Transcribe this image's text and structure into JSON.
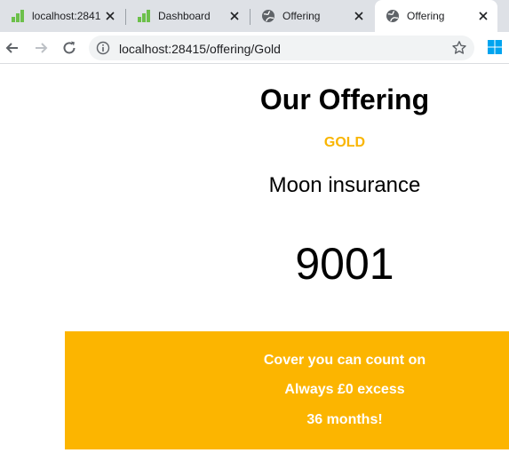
{
  "browser": {
    "tabs": [
      {
        "label": "localhost:2841",
        "icon": "green-stairs-icon",
        "active": false
      },
      {
        "label": "Dashboard",
        "icon": "green-stairs-icon",
        "active": false
      },
      {
        "label": "Offering",
        "icon": "globe-icon",
        "active": false
      },
      {
        "label": "Offering",
        "icon": "globe-icon",
        "active": true
      }
    ],
    "url": "localhost:28415/offering/Gold",
    "colors": {
      "tabstrip": "#dee1e6",
      "omnibox": "#f1f3f4",
      "favicon_green": "#6cc04a"
    }
  },
  "page": {
    "title": "Our Offering",
    "tier": "GOLD",
    "product": "Moon insurance",
    "price": "9001",
    "benefits": [
      "Cover you can count on",
      "Always £0 excess",
      "36 months!"
    ],
    "colors": {
      "accent": "#fcb500",
      "tier_text": "#f9b500",
      "banner_text": "#ffffff"
    }
  }
}
